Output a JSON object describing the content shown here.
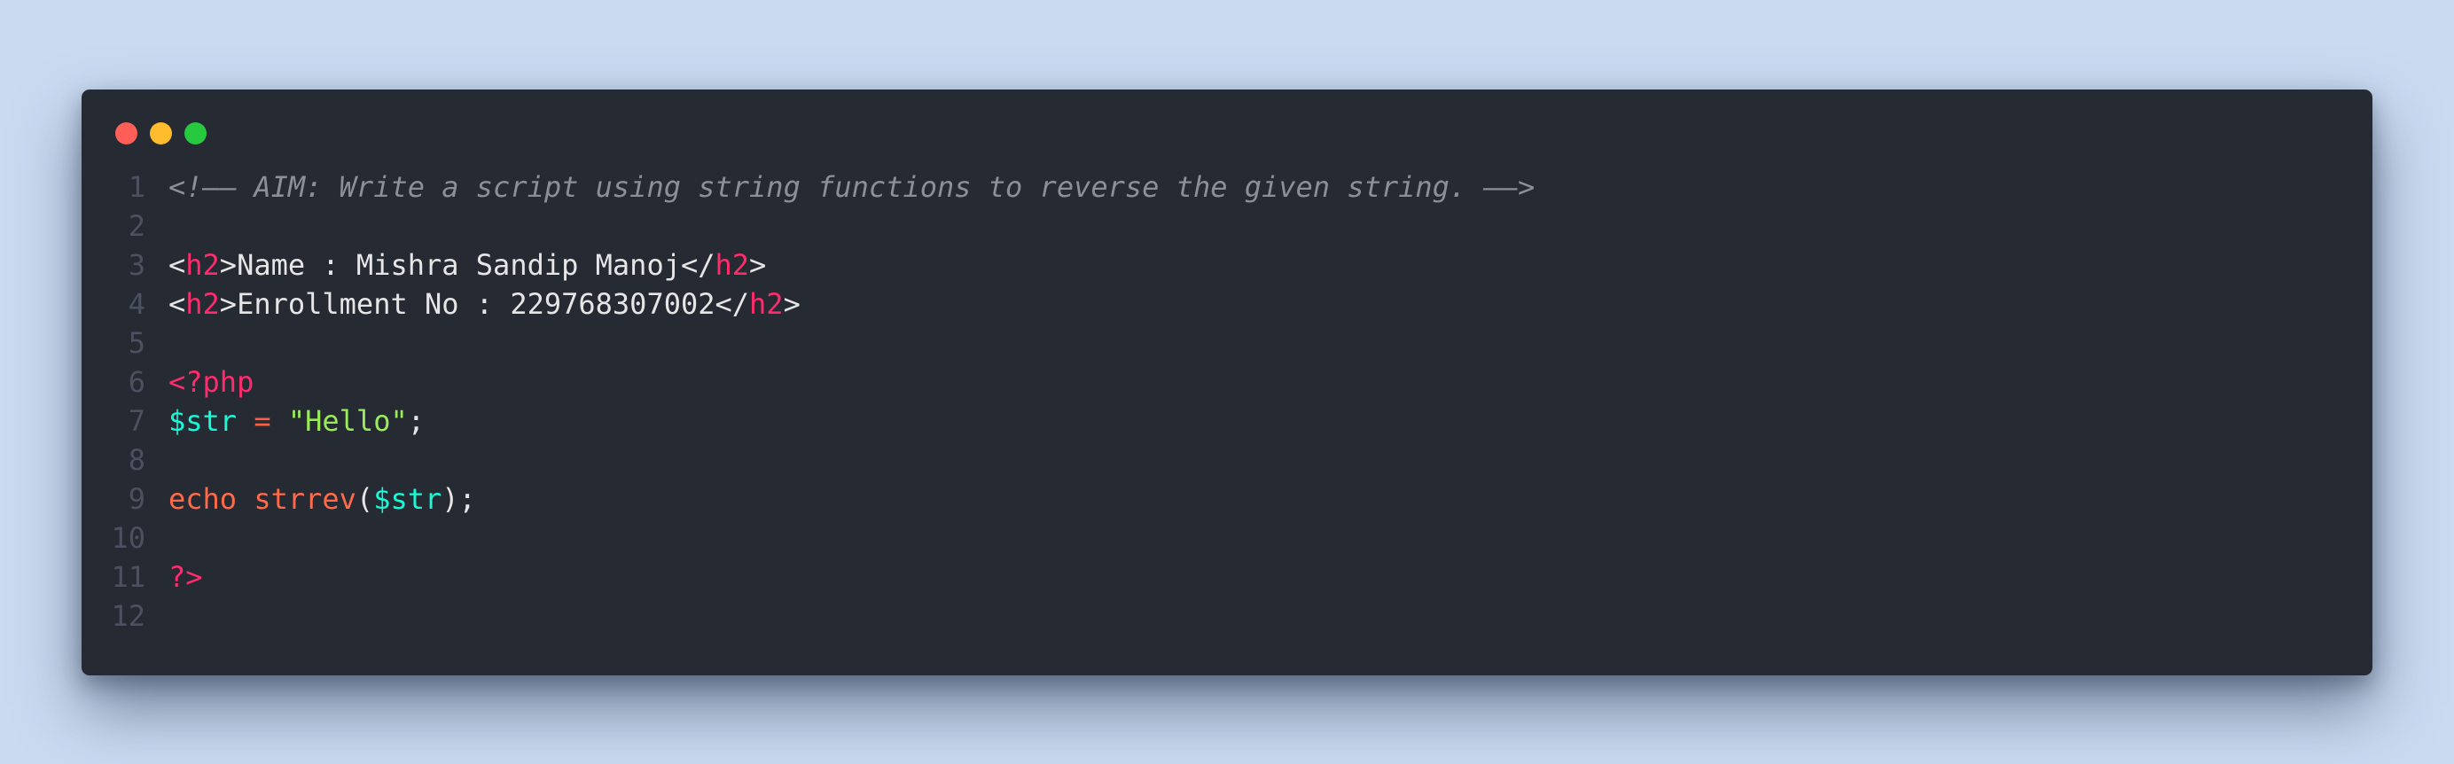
{
  "window": {
    "controls": [
      "close",
      "minimize",
      "maximize"
    ]
  },
  "lines": [
    {
      "n": "1",
      "comment": "<!–– AIM: Write a script using string functions to reverse the given string. ––>"
    },
    {
      "n": "2"
    },
    {
      "n": "3",
      "open_lt": "<",
      "open_tag": "h2",
      "open_gt": ">",
      "text": "Name : Mishra Sandip Manoj",
      "close_lt": "</",
      "close_tag": "h2",
      "close_gt": ">"
    },
    {
      "n": "4",
      "open_lt": "<",
      "open_tag": "h2",
      "open_gt": ">",
      "text": "Enrollment No : 229768307002",
      "close_lt": "</",
      "close_tag": "h2",
      "close_gt": ">"
    },
    {
      "n": "5"
    },
    {
      "n": "6",
      "php_open": "<?php"
    },
    {
      "n": "7",
      "var": "$str",
      "space1": " ",
      "op": "=",
      "space2": " ",
      "string": "\"Hello\"",
      "semi": ";"
    },
    {
      "n": "8"
    },
    {
      "n": "9",
      "keyword": "echo",
      "space": " ",
      "func": "strrev",
      "lparen": "(",
      "arg": "$str",
      "rparen": ");"
    },
    {
      "n": "10"
    },
    {
      "n": "11",
      "php_close": "?>"
    },
    {
      "n": "12"
    }
  ],
  "colors": {
    "background": "#c9daf1",
    "editor": "#262a33",
    "tag": "#ff2c6d",
    "variable": "#19f9d8",
    "string": "#9bea5b",
    "function": "#ff6b4a",
    "comment": "#8a8f9a"
  }
}
